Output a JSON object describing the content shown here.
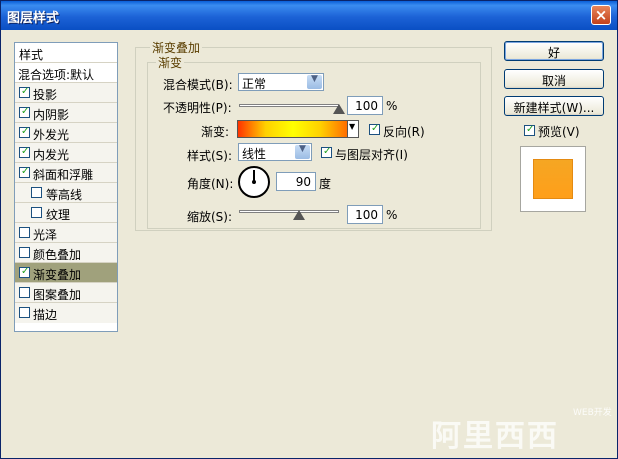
{
  "window": {
    "title": "图层样式",
    "close": "×"
  },
  "styles_list": {
    "items": [
      {
        "label": "样式",
        "checked": null
      },
      {
        "label": "混合选项:默认",
        "checked": null
      },
      {
        "label": "投影",
        "checked": true
      },
      {
        "label": "内阴影",
        "checked": true
      },
      {
        "label": "外发光",
        "checked": true
      },
      {
        "label": "内发光",
        "checked": true
      },
      {
        "label": "斜面和浮雕",
        "checked": true
      },
      {
        "label": "等高线",
        "checked": false
      },
      {
        "label": "纹理",
        "checked": false
      },
      {
        "label": "光泽",
        "checked": false
      },
      {
        "label": "颜色叠加",
        "checked": false
      },
      {
        "label": "渐变叠加",
        "checked": true,
        "selected": true
      },
      {
        "label": "图案叠加",
        "checked": false
      },
      {
        "label": "描边",
        "checked": false
      }
    ]
  },
  "panel": {
    "group_title": "渐变叠加",
    "subgroup_title": "渐变",
    "blend_mode_label": "混合模式(B):",
    "blend_mode_value": "正常",
    "opacity_label": "不透明性(P):",
    "opacity_value": "100",
    "opacity_fraction": 1.0,
    "percent": "%",
    "gradient_label": "渐变:",
    "gradient_colors": [
      "#ff3300",
      "#ffd000",
      "#ffff00",
      "#ffd000",
      "#ff6a00"
    ],
    "reverse_label": "反向(R)",
    "reverse_checked": true,
    "style_label": "样式(S):",
    "style_value": "线性",
    "align_label": "与图层对齐(I)",
    "align_checked": true,
    "angle_label": "角度(N):",
    "angle_value": "90",
    "angle_unit": "度",
    "scale_label": "缩放(S):",
    "scale_value": "100",
    "scale_fraction": 0.6
  },
  "buttons": {
    "ok": "好",
    "cancel": "取消",
    "new_style": "新建样式(W)...",
    "preview_label": "预览(V)",
    "preview_checked": true
  },
  "watermark": {
    "text": "阿里西西",
    "small": "WEB开发"
  }
}
